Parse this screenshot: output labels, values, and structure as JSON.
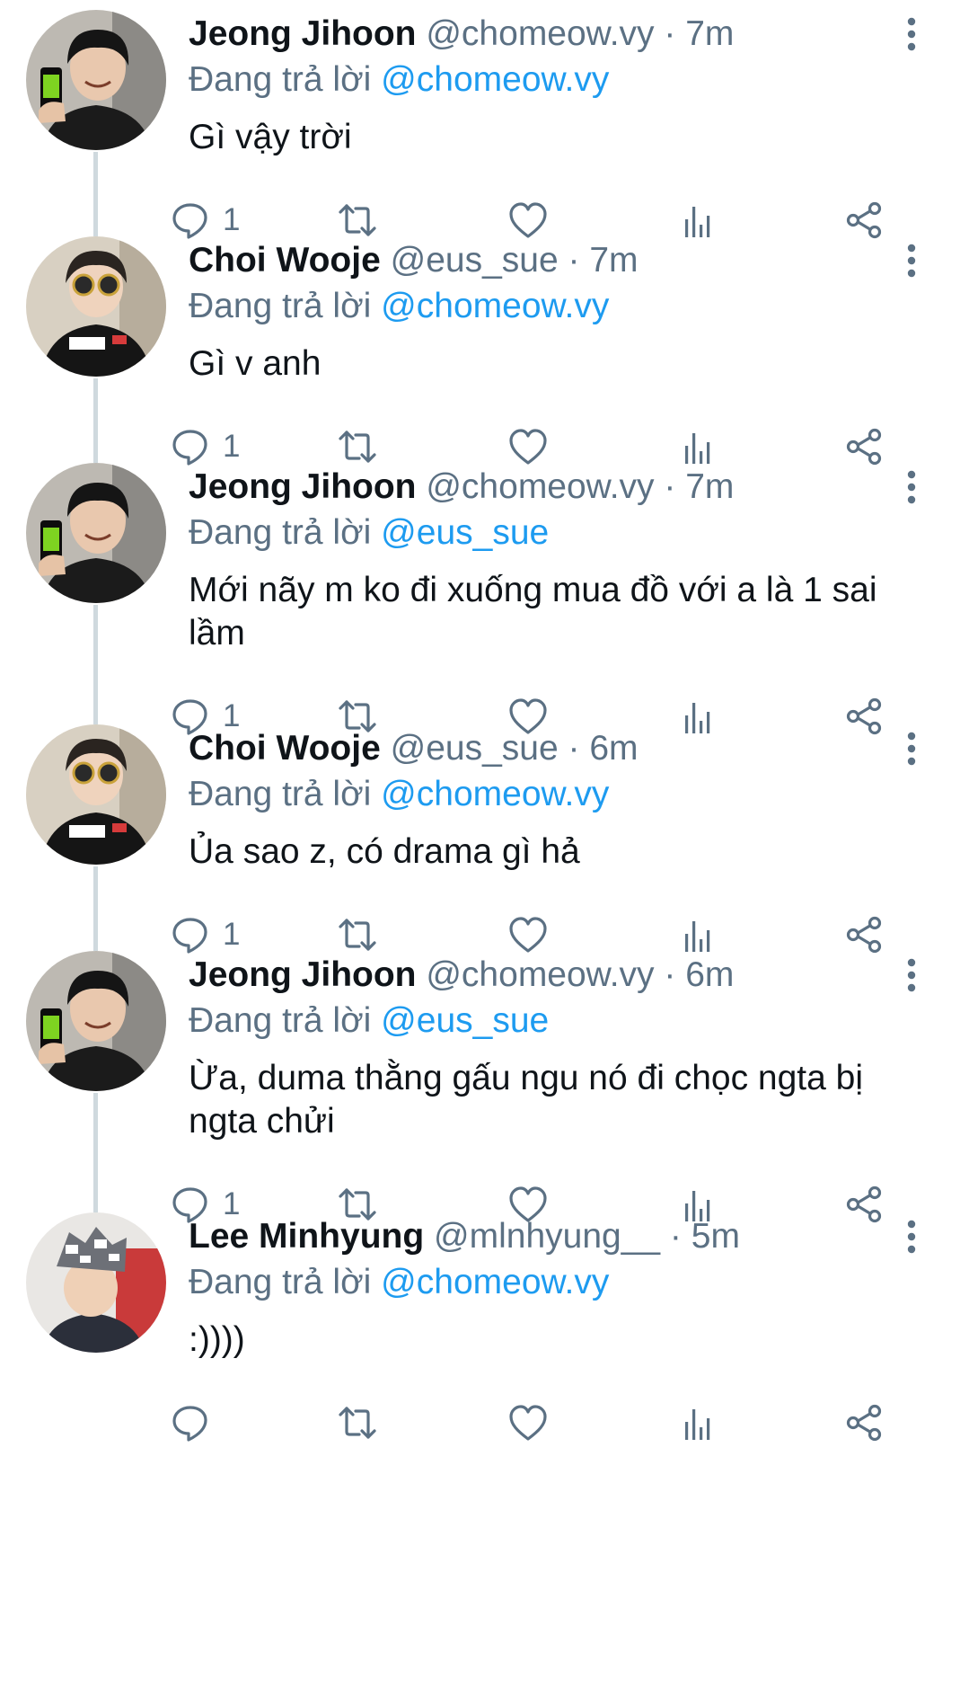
{
  "reply_prefix": "Đang trả lời",
  "tweets": [
    {
      "name": "Jeong Jihoon",
      "handle": "@chomeow.vy",
      "time": "7m",
      "reply_to": "@chomeow.vy",
      "text": "Gì vậy trời",
      "reply_count": "1",
      "avatar_icon": "jeong-jihoon-avatar"
    },
    {
      "name": "Choi Wooje",
      "handle": "@eus_sue",
      "time": "7m",
      "reply_to": "@chomeow.vy",
      "text": "Gì v anh",
      "reply_count": "1",
      "avatar_icon": "choi-wooje-avatar"
    },
    {
      "name": "Jeong Jihoon",
      "handle": "@chomeow.vy",
      "time": "7m",
      "reply_to": "@eus_sue",
      "text": "Mới nãy m ko đi xuống mua đồ với a là 1 sai lầm",
      "reply_count": "1",
      "avatar_icon": "jeong-jihoon-avatar"
    },
    {
      "name": "Choi Wooje",
      "handle": "@eus_sue",
      "time": "6m",
      "reply_to": "@chomeow.vy",
      "text": "Ủa sao z, có drama gì hả",
      "reply_count": "1",
      "avatar_icon": "choi-wooje-avatar"
    },
    {
      "name": "Jeong Jihoon",
      "handle": "@chomeow.vy",
      "time": "6m",
      "reply_to": "@eus_sue",
      "text": "Ừa, duma thằng gấu ngu nó đi chọc ngta bị ngta chửi",
      "reply_count": "1",
      "avatar_icon": "jeong-jihoon-avatar"
    },
    {
      "name": "Lee Minhyung",
      "handle": "@mlnhyung__",
      "time": "5m",
      "reply_to": "@chomeow.vy",
      "text": ":))))",
      "reply_count": "",
      "avatar_icon": "lee-minhyung-avatar"
    }
  ],
  "colors": {
    "text": "#0f1419",
    "secondary": "#5b7083",
    "link": "#1d9bf0",
    "thread_line": "#cfd9de",
    "icon": "#5b7083"
  }
}
